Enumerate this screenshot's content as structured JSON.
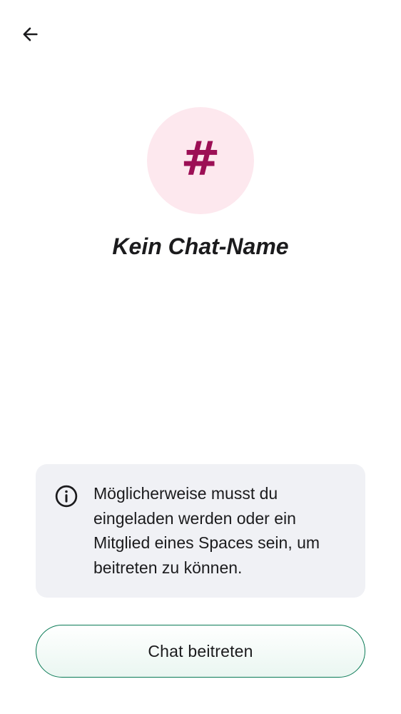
{
  "header": {
    "back_icon": "arrow-left-icon"
  },
  "room": {
    "avatar_glyph": "#",
    "avatar_bg_color": "#fde8ee",
    "avatar_glyph_color": "#9c0f55",
    "title": "Kein Chat-Name"
  },
  "info": {
    "icon": "info-icon",
    "text": "Möglicherweise musst du eingeladen werden oder ein Mitglied eines Spaces sein, um beitreten zu können."
  },
  "actions": {
    "join_label": "Chat beitreten",
    "accent_color": "#0a7a56"
  }
}
